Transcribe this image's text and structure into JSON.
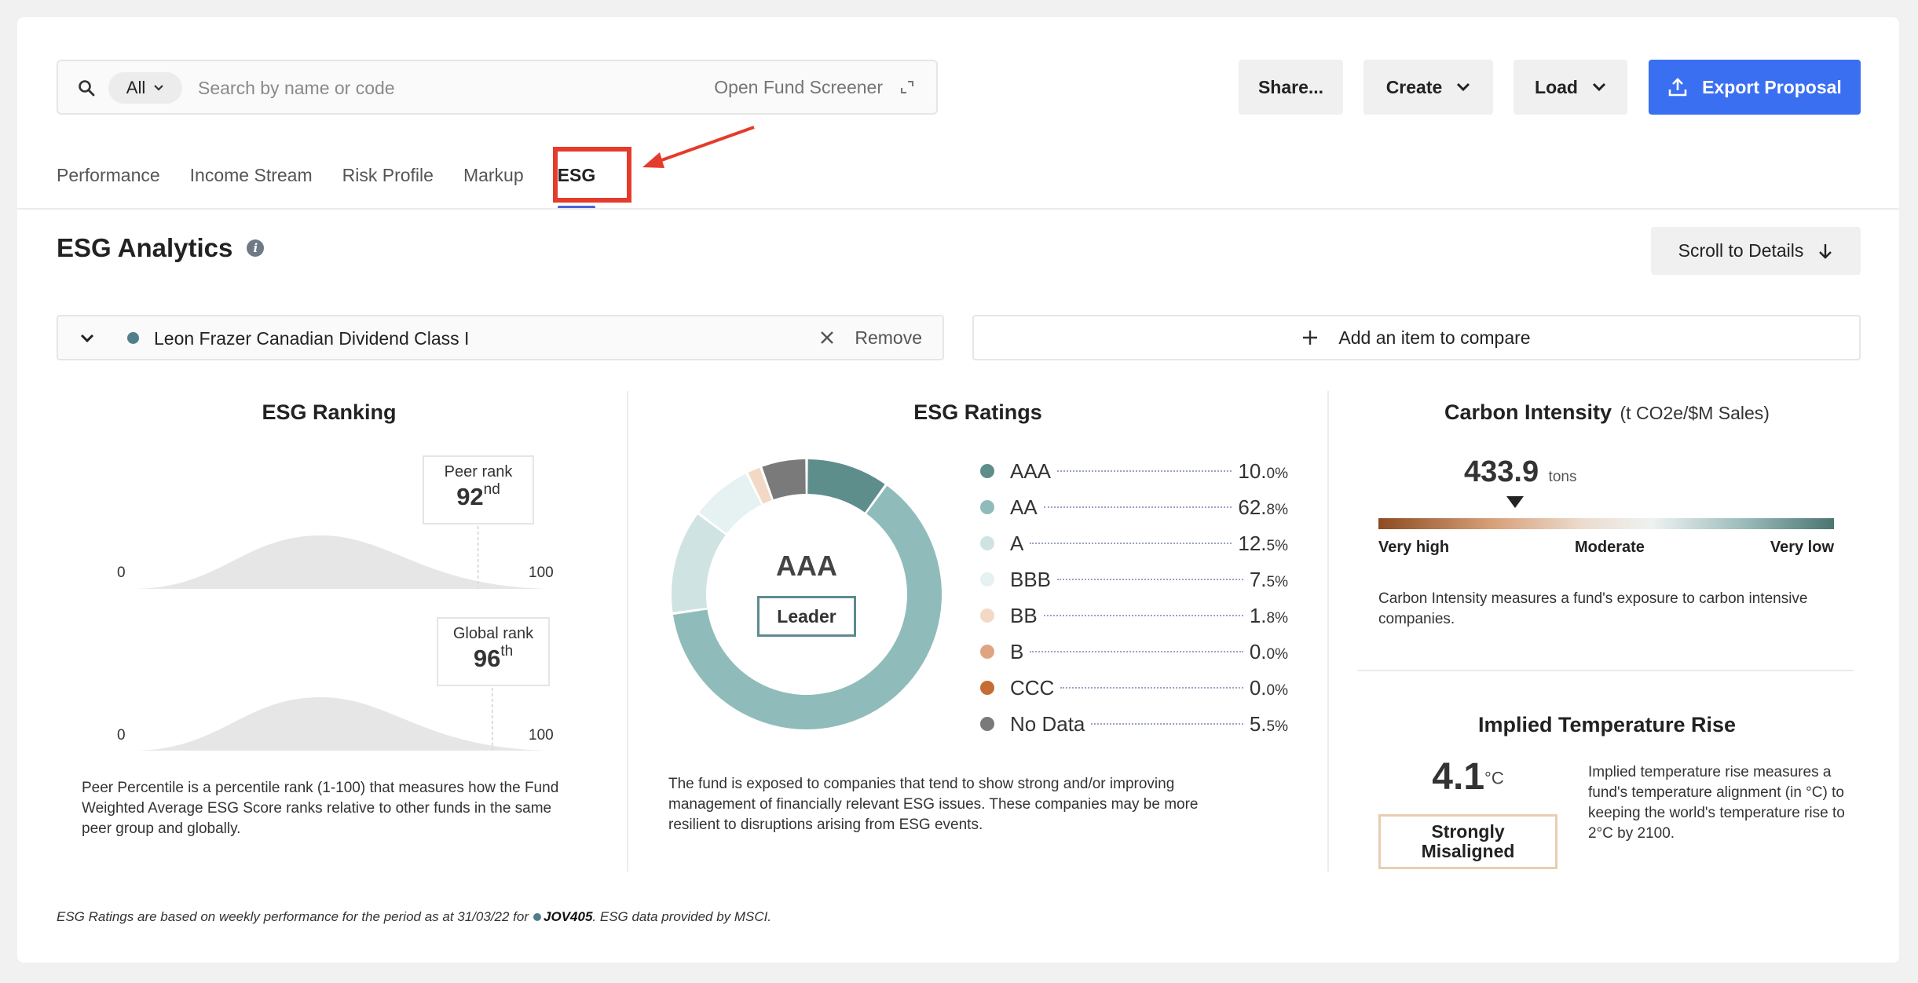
{
  "search": {
    "scope": "All",
    "placeholder": "Search by name or code",
    "open_screener": "Open Fund Screener"
  },
  "toolbar": {
    "share": "Share...",
    "create": "Create",
    "load": "Load",
    "export": "Export Proposal"
  },
  "tabs": [
    {
      "label": "Performance"
    },
    {
      "label": "Income Stream"
    },
    {
      "label": "Risk Profile"
    },
    {
      "label": "Markup"
    },
    {
      "label": "ESG",
      "active": true
    }
  ],
  "page": {
    "title": "ESG Analytics",
    "scroll_to_details": "Scroll to Details"
  },
  "selected_fund": {
    "name": "Leon Frazer Canadian Dividend Class I",
    "remove_label": "Remove",
    "color": "#4f7f8a"
  },
  "compare": {
    "label": "Add an item to compare"
  },
  "ranking": {
    "title": "ESG Ranking",
    "peer": {
      "label": "Peer rank",
      "value": "92",
      "suffix": "nd",
      "rank": 92
    },
    "global": {
      "label": "Global rank",
      "value": "96",
      "suffix": "th",
      "rank": 96
    },
    "axis_min": "0",
    "axis_max": "100",
    "description": "Peer Percentile is a percentile rank (1-100) that measures how the Fund Weighted Average ESG Score ranks relative to other funds in the same peer group and globally."
  },
  "ratings": {
    "title": "ESG Ratings",
    "overall": "AAA",
    "category": "Leader",
    "items": [
      {
        "label": "AAA",
        "value": "10.",
        "decimals": "0%",
        "pct": 10.0,
        "color": "#5e8e8c"
      },
      {
        "label": "AA",
        "value": "62.",
        "decimals": "8%",
        "pct": 62.8,
        "color": "#8fbcba"
      },
      {
        "label": "A",
        "value": "12.",
        "decimals": "5%",
        "pct": 12.5,
        "color": "#cfe3e2"
      },
      {
        "label": "BBB",
        "value": "7.",
        "decimals": "5%",
        "pct": 7.5,
        "color": "#e6f1f1"
      },
      {
        "label": "BB",
        "value": "1.",
        "decimals": "8%",
        "pct": 1.8,
        "color": "#f3d9c5"
      },
      {
        "label": "B",
        "value": "0.",
        "decimals": "0%",
        "pct": 0.0,
        "color": "#dfa583"
      },
      {
        "label": "CCC",
        "value": "0.",
        "decimals": "0%",
        "pct": 0.0,
        "color": "#c46e35"
      },
      {
        "label": "No Data",
        "value": "5.",
        "decimals": "5%",
        "pct": 5.5,
        "color": "#7a7a7a"
      }
    ],
    "description": "The fund is exposed to companies that tend to show strong and/or improving management of financially relevant ESG issues. These companies may be more resilient to disruptions arising from ESG events."
  },
  "carbon": {
    "title": "Carbon Intensity",
    "unit": "(t CO2e/$M Sales)",
    "value": "433.9",
    "value_unit": "tons",
    "scale_position": 0.3,
    "scale_labels": [
      "Very high",
      "Moderate",
      "Very low"
    ],
    "description": "Carbon Intensity measures a fund's exposure to carbon intensive companies."
  },
  "temperature": {
    "title": "Implied Temperature Rise",
    "value": "4.1",
    "unit": "°C",
    "status_line1": "Strongly",
    "status_line2": "Misaligned",
    "description": "Implied temperature rise measures a fund's temperature alignment (in °C) to keeping the world's temperature rise to 2°C by 2100."
  },
  "footnote": {
    "prefix": "ESG Ratings are based on weekly performance for the period as at 31/03/22 for",
    "code": "JOV405",
    "suffix": ". ESG data provided by MSCI."
  }
}
